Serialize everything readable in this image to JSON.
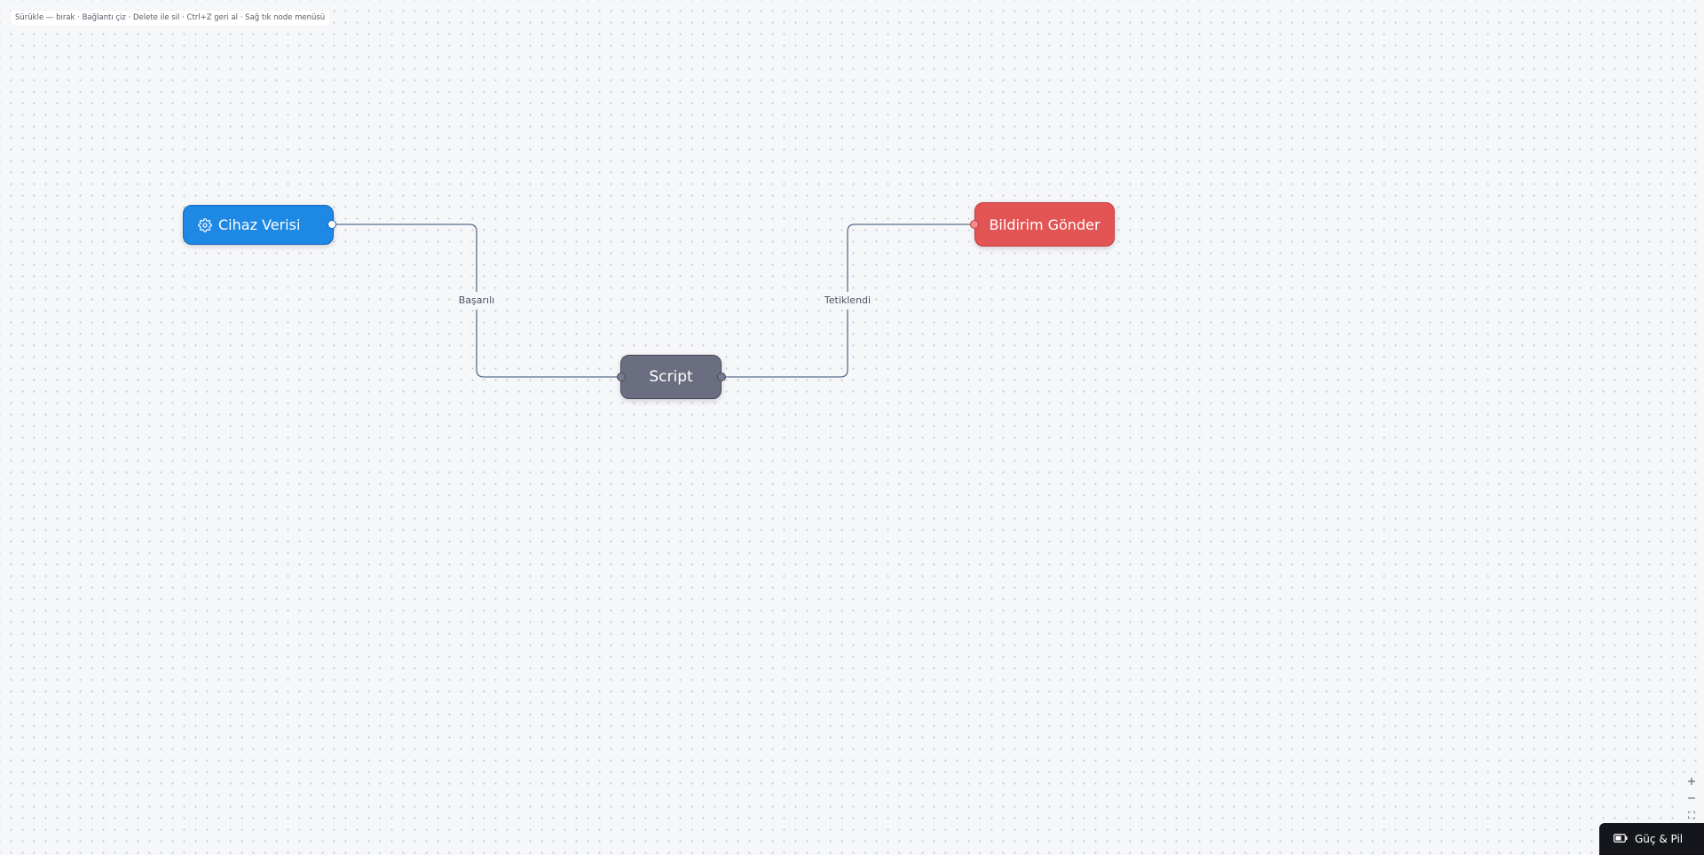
{
  "hint": "Sürükle — bırak · Bağlantı çiz · Delete ile sil · Ctrl+Z geri al · Sağ tık node menüsü",
  "nodes": {
    "device_data": {
      "label": "Cihaz Verisi",
      "icon": "gear-icon",
      "color": "#1e88e5"
    },
    "script": {
      "label": "Script",
      "color": "#6b6e80"
    },
    "send_notification": {
      "label": "Bildirim Gönder",
      "color": "#e35454"
    }
  },
  "edges": {
    "successful": {
      "label": "Başarılı"
    },
    "triggered": {
      "label": "Tetiklendi"
    }
  },
  "controls": {
    "zoom_in": "+",
    "zoom_out": "−",
    "fit_view": "⛶"
  },
  "power_button": {
    "label": "Güç & Pil",
    "icon": "battery-icon"
  }
}
